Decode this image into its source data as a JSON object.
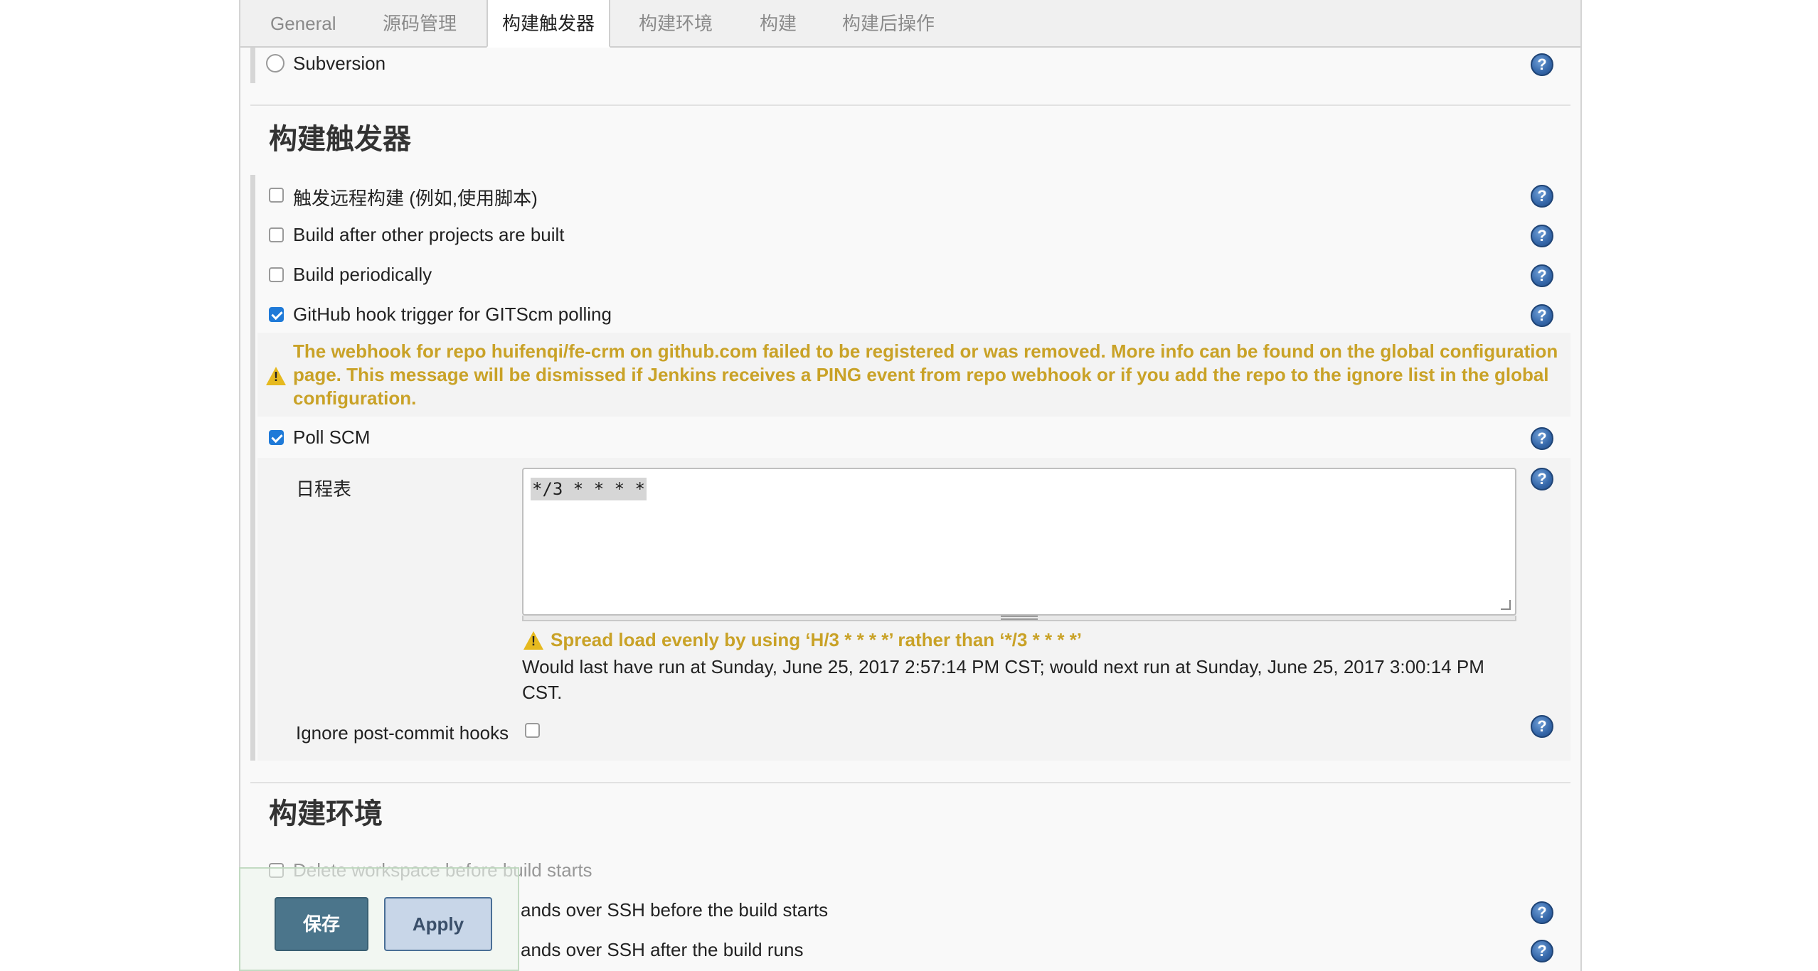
{
  "tabs": [
    {
      "label": "General",
      "active": false
    },
    {
      "label": "源码管理",
      "active": false
    },
    {
      "label": "构建触发器",
      "active": true
    },
    {
      "label": "构建环境",
      "active": false
    },
    {
      "label": "构建",
      "active": false
    },
    {
      "label": "构建后操作",
      "active": false
    }
  ],
  "scm": {
    "subversion_label": "Subversion"
  },
  "triggers": {
    "section_title": "构建触发器",
    "items": [
      {
        "label": "触发远程构建 (例如,使用脚本)",
        "checked": false
      },
      {
        "label": "Build after other projects are built",
        "checked": false
      },
      {
        "label": "Build periodically",
        "checked": false
      },
      {
        "label": "GitHub hook trigger for GITScm polling",
        "checked": true
      }
    ],
    "webhook_warning": "The webhook for repo huifenqi/fe-crm on github.com failed to be registered or was removed. More info can be found on the global configuration page. This message will be dismissed if Jenkins receives a PING event from repo webhook or if you add the repo to the ignore list in the global configuration.",
    "poll_scm": {
      "label": "Poll SCM",
      "checked": true,
      "schedule_label": "日程表",
      "schedule_value": "*/3 * * * *",
      "spread_warning": "Spread load evenly by using ‘H/3 * * * *’ rather than ‘*/3 * * * *’",
      "run_info": "Would last have run at Sunday, June 25, 2017 2:57:14 PM CST; would next run at Sunday, June 25, 2017 3:00:14 PM CST.",
      "ignore_hooks_label": "Ignore post-commit hooks",
      "ignore_hooks_checked": false
    }
  },
  "build_env": {
    "section_title": "构建环境",
    "items": [
      {
        "label": "Delete workspace before build starts"
      },
      {
        "label": "Send files or execute commands over SSH before the build starts",
        "visible_text": "ands over SSH before the build starts"
      },
      {
        "label": "Send files or execute commands over SSH after the build runs",
        "visible_text": "ands over SSH after the build runs"
      }
    ]
  },
  "buttons": {
    "save_label": "保存",
    "apply_label": "Apply"
  },
  "icons": {
    "help": "help-icon",
    "warning": "warning-icon"
  },
  "colors": {
    "accent": "#1f7ad8",
    "warning_text": "#c9a227",
    "save_button": "#4b758b",
    "apply_button": "#c8d6e8"
  }
}
